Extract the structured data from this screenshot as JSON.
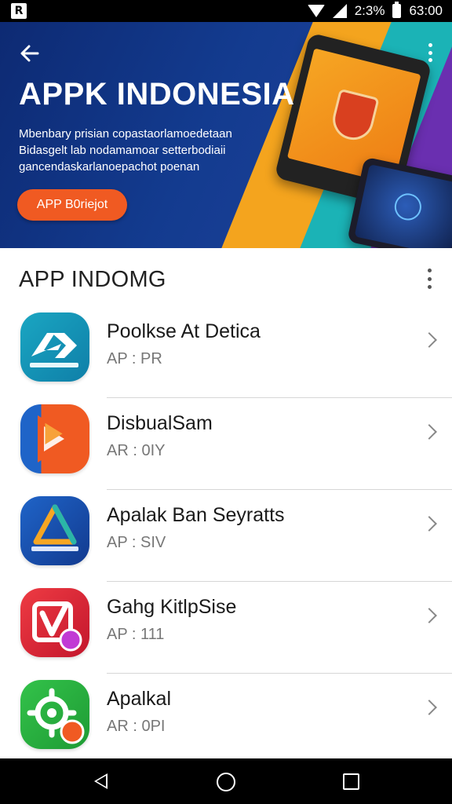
{
  "status_bar": {
    "battery_text": "2:3%",
    "time": "63:00",
    "icons": [
      "notification-icon",
      "wifi-icon",
      "signal-icon",
      "battery-icon"
    ]
  },
  "banner": {
    "title": "APPK INDONESIA",
    "description": "Mbenbary prisian copastaorlamoedetaan Bidasgelt lab nodamamoar setterbodiaii gancendaskarlanoepachot poenan",
    "cta_label": "APP B0riejot",
    "colors": {
      "background": "#133b8f",
      "orange": "#f4a41e",
      "teal": "#1bb3b6",
      "purple": "#6a2fb0",
      "cta": "#f05a22"
    }
  },
  "section": {
    "title": "APP INDOMG"
  },
  "apps": [
    {
      "name": "Poolkse At Detica",
      "subtitle": "AP : PR",
      "icon": "double-arrow-icon"
    },
    {
      "name": "DisbualSam",
      "subtitle": "AR : 0IY",
      "icon": "play-arrow-icon"
    },
    {
      "name": "Apalak Ban Seyratts",
      "subtitle": "AP : SIV",
      "icon": "triangle-logo-icon"
    },
    {
      "name": "Gahg KitlpSise",
      "subtitle": "AP : 111",
      "icon": "v-check-icon"
    },
    {
      "name": "Apalkal",
      "subtitle": "AR : 0PI",
      "icon": "gear-person-icon"
    }
  ]
}
